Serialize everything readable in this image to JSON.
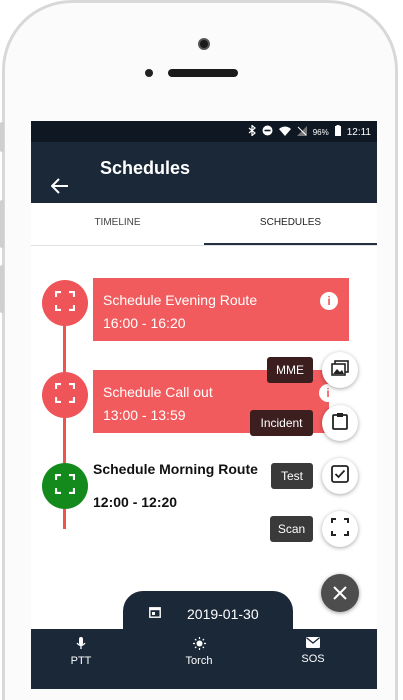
{
  "statusbar": {
    "battery": "96%",
    "time": "12:11"
  },
  "appbar": {
    "title": "Schedules"
  },
  "tabs": [
    {
      "label": "TIMELINE",
      "active": false
    },
    {
      "label": "SCHEDULES",
      "active": true
    }
  ],
  "schedules": [
    {
      "name": "Schedule Evening Route",
      "time": "16:00 - 16:20",
      "status": "red"
    },
    {
      "name": "Schedule Call out",
      "time": "13:00 - 13:59",
      "status": "red"
    },
    {
      "name": "Schedule Morning Route",
      "time": "12:00 - 12:20",
      "status": "green"
    }
  ],
  "speed_dial": [
    {
      "label": "MME",
      "icon": "image-icon"
    },
    {
      "label": "Incident",
      "icon": "clipboard-icon"
    },
    {
      "label": "Test",
      "icon": "checkbox-icon"
    },
    {
      "label": "Scan",
      "icon": "scan-icon"
    }
  ],
  "date": "2019-01-30",
  "nav": [
    {
      "label": "PTT",
      "icon": "mic-icon"
    },
    {
      "label": "Torch",
      "icon": "torch-icon"
    },
    {
      "label": "SOS",
      "icon": "mail-icon"
    }
  ],
  "colors": {
    "appbar": "#1b2838",
    "red": "#f25b5d",
    "green": "#148a1c"
  }
}
